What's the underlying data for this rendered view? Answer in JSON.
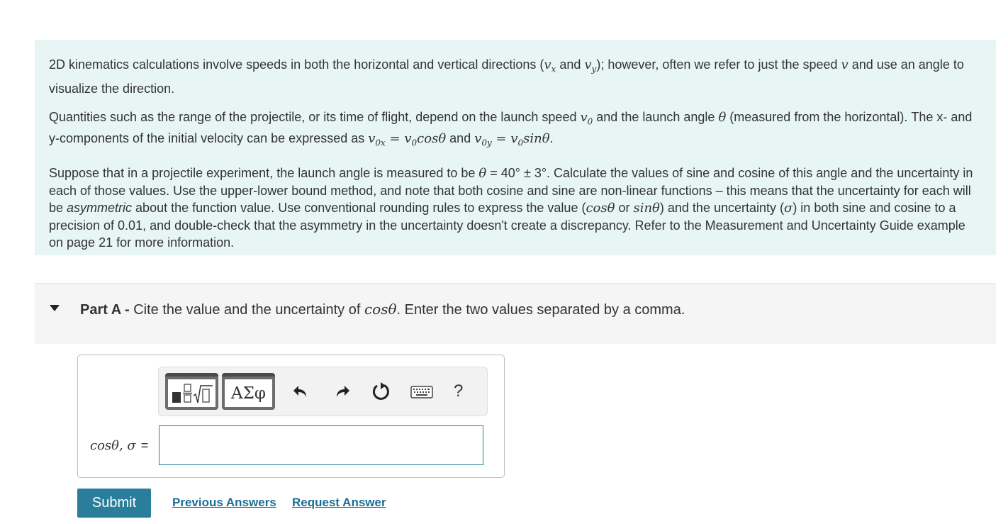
{
  "intro": {
    "p1": {
      "t1": "2D kinematics calculations involve speeds in both the horizontal and vertical directions (",
      "vx": "v",
      "vx_sub": "x",
      "t2": " and ",
      "vy": "v",
      "vy_sub": "y",
      "t3": "); however, often we refer to just the speed ",
      "v": "v",
      "t4": " and use an angle to visualize the direction."
    },
    "p2": {
      "t1": "Quantities such as the range of the projectile, or its time of flight, depend on the launch speed ",
      "v0": "v",
      "v0_sub": "0",
      "t2": " and the launch angle ",
      "theta": "θ",
      "t3": " (measured from the horizontal). The x- and y-components of the initial velocity can be expressed as ",
      "eq1": "v",
      "eq1_sub": "0x",
      "eq1_rhs": " = v",
      "eq1_rhs_sub": "0",
      "eq1_tail": "cosθ",
      "t4": " and ",
      "eq2": "v",
      "eq2_sub": "0y",
      "eq2_rhs": " = v",
      "eq2_rhs_sub": "0",
      "eq2_tail": "sinθ",
      "t5": "."
    },
    "p3": {
      "t1": "Suppose that in a projectile experiment, the launch angle is measured to be ",
      "theta": "θ",
      "t2": " = 40° ± 3°. Calculate the values of sine and cosine of this angle and the uncertainty in each of those values. Use the upper-lower bound method, and note that both cosine and sine are non-linear functions – this means that the uncertainty for each will be ",
      "asym": "asymmetric",
      "t3": " about the function value. Use conventional rounding rules to express the value (",
      "cos": "cosθ",
      "t4": " or ",
      "sin": "sinθ",
      "t5": ") and the uncertainty (",
      "sigma": "σ",
      "t6": ") in both sine and cosine to a precision of 0.01, and double-check that the asymmetry in the uncertainty doesn't create a discrepancy. Refer to the Measurement and Uncertainty Guide example on page 21 for more information."
    }
  },
  "part": {
    "label": "Part A - ",
    "t1": "Cite the value and the uncertainty of ",
    "cos": "cosθ",
    "t2": ". Enter the two values separated by a comma."
  },
  "toolbar": {
    "symbols_label": "ΑΣφ",
    "help_label": "?"
  },
  "answer": {
    "label_math": "cosθ, σ",
    "label_eq": " =",
    "value": ""
  },
  "actions": {
    "submit": "Submit",
    "previous_answers": "Previous Answers",
    "request_answer": "Request Answer"
  },
  "colors": {
    "intro_bg": "#e8f5f5",
    "part_bg": "#f5f5f5",
    "submit_bg": "#2a7d9b",
    "link": "#1a6e96",
    "input_border": "#2e7d9a"
  }
}
